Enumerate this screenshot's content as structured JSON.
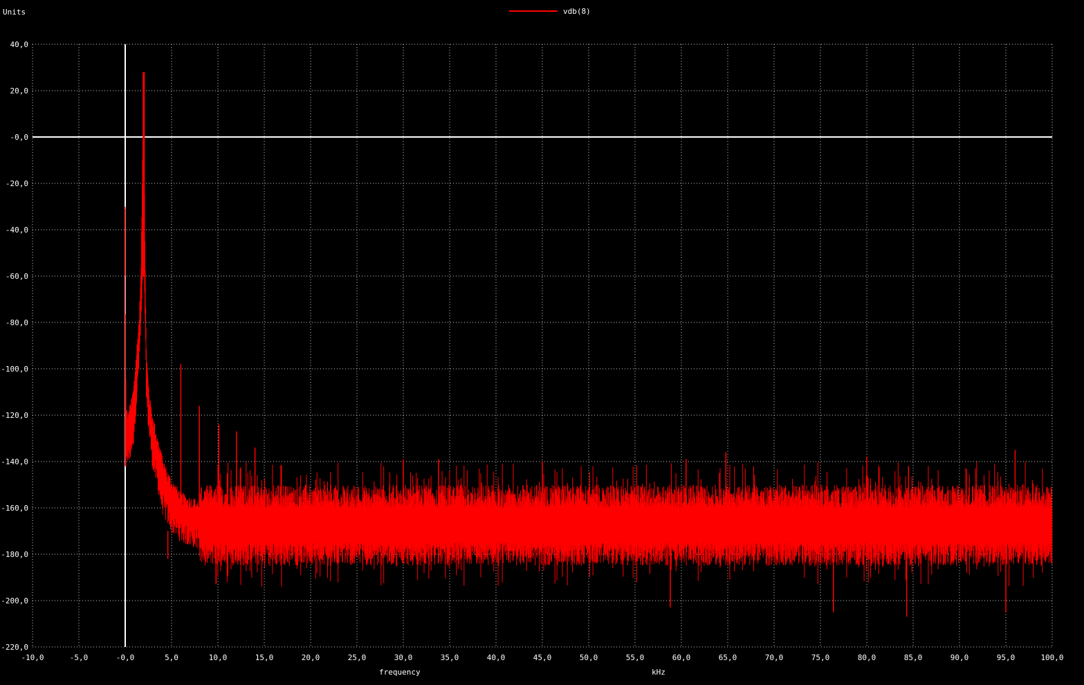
{
  "window": {
    "units_label": "Units"
  },
  "legend": {
    "label": "vdb(8)",
    "color": "#ff0000",
    "placement": "top-center"
  },
  "axes": {
    "xlabel": "frequency",
    "xunit": "kHz",
    "x_ticks": [
      "-10,0",
      "-5,0",
      "-0,0",
      "5,0",
      "10,0",
      "15,0",
      "20,0",
      "25,0",
      "30,0",
      "35,0",
      "40,0",
      "45,0",
      "50,0",
      "55,0",
      "60,0",
      "65,0",
      "70,0",
      "75,0",
      "80,0",
      "85,0",
      "90,0",
      "95,0",
      "100,0"
    ],
    "y_ticks": [
      "40,0",
      "20,0",
      "-0,0",
      "-20,0",
      "-40,0",
      "-60,0",
      "-80,0",
      "-100,0",
      "-120,0",
      "-140,0",
      "-160,0",
      "-180,0",
      "-200,0",
      "-220,0"
    ]
  },
  "colors": {
    "background": "#000000",
    "grid": "#d0d0d0",
    "zero_axes": "#ffffff",
    "trace": "#ff0000"
  },
  "chart_data": {
    "type": "line",
    "xlim": [
      -10,
      100
    ],
    "ylim": [
      -220,
      40
    ],
    "grid": true,
    "legend_placement": "top-center",
    "series": [
      {
        "name": "vdb(8)",
        "color": "#ff0000",
        "noise_floor": {
          "x_from": 8,
          "x_to": 100,
          "center": -168,
          "upper": -155,
          "lower": -180
        },
        "x": [
          0.0,
          0.05,
          0.1,
          0.2,
          0.3,
          0.4,
          0.5,
          0.7,
          0.9,
          1.1,
          1.3,
          1.5,
          1.7,
          1.8,
          1.9,
          2.0,
          2.1,
          2.2,
          2.3,
          2.5,
          2.7,
          3.0,
          3.5,
          4.0,
          4.5,
          5.0,
          6.0,
          7.0,
          8.0,
          9.0,
          10.0
        ],
        "upper": [
          -31,
          -93,
          -118,
          -120,
          -123,
          -120,
          -118,
          -115,
          -110,
          -100,
          -90,
          -80,
          -60,
          -30,
          0,
          28,
          -30,
          -75,
          -95,
          -108,
          -116,
          -123,
          -132,
          -140,
          -146,
          -150,
          -156,
          -158,
          -159,
          -160,
          -160
        ],
        "lower": [
          -140,
          -145,
          -143,
          -135,
          -138,
          -138,
          -136,
          -132,
          -128,
          -118,
          -108,
          -95,
          -80,
          -70,
          -60,
          -52,
          -68,
          -92,
          -112,
          -122,
          -130,
          -140,
          -148,
          -158,
          -162,
          -166,
          -170,
          -172,
          -173,
          -174,
          -174
        ],
        "peaks": [
          {
            "x": 0.0,
            "y": -31
          },
          {
            "x": 2.0,
            "y": 28
          },
          {
            "x": 6.0,
            "y": -98
          },
          {
            "x": 8.0,
            "y": -116
          },
          {
            "x": 10.1,
            "y": -124
          },
          {
            "x": 12.0,
            "y": -127
          },
          {
            "x": 14.0,
            "y": -134
          },
          {
            "x": 30.0,
            "y": -139
          },
          {
            "x": 33.8,
            "y": -139
          },
          {
            "x": 45.0,
            "y": -140
          },
          {
            "x": 60.5,
            "y": -139
          },
          {
            "x": 64.8,
            "y": -136
          },
          {
            "x": 80.0,
            "y": -138
          },
          {
            "x": 84.5,
            "y": -142
          },
          {
            "x": 96.0,
            "y": -135
          }
        ],
        "dips": [
          {
            "x": 4.6,
            "y": -182
          },
          {
            "x": 9.8,
            "y": -193
          },
          {
            "x": 58.8,
            "y": -203
          },
          {
            "x": 76.4,
            "y": -205
          },
          {
            "x": 84.3,
            "y": -207
          },
          {
            "x": 95.0,
            "y": -205
          }
        ]
      }
    ]
  }
}
